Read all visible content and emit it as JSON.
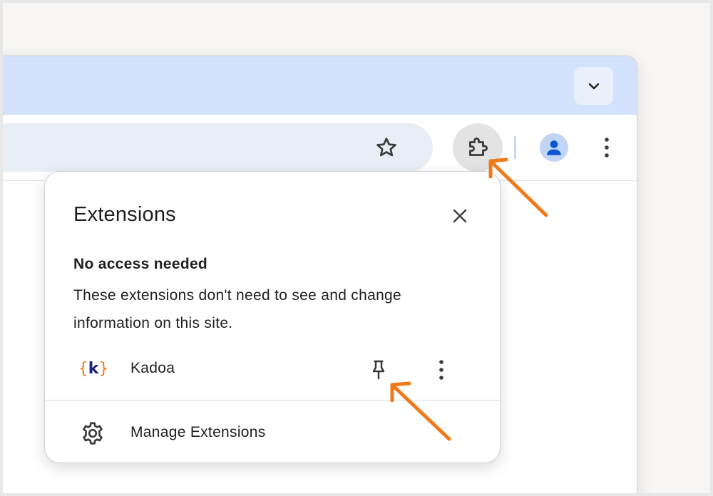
{
  "browser": {
    "tab_search_icon": "chevron-down-icon",
    "omnibox_icon": "star-icon",
    "extensions_icon": "puzzle-icon",
    "profile_icon": "person-icon",
    "menu_icon": "more-vert-icon"
  },
  "popup": {
    "title": "Extensions",
    "close_icon": "close-icon",
    "section_heading": "No access needed",
    "section_description": "These extensions don't need to see and change information on this site.",
    "extensions": [
      {
        "name": "Kadoa",
        "logo_left": "{",
        "logo_letter": "k",
        "logo_right": "}",
        "pin_icon": "pin-icon",
        "more_icon": "more-vert-icon"
      }
    ],
    "manage_label": "Manage Extensions",
    "manage_icon": "gear-icon"
  },
  "annotations": {
    "arrow_color": "#f07a1a"
  },
  "colors": {
    "tabstrip": "#d3e3fd",
    "omnibox": "#e9eef6",
    "accent_brand_orange": "#f07a1a",
    "accent_brand_navy": "#24227a",
    "avatar": "#0b57d0"
  }
}
